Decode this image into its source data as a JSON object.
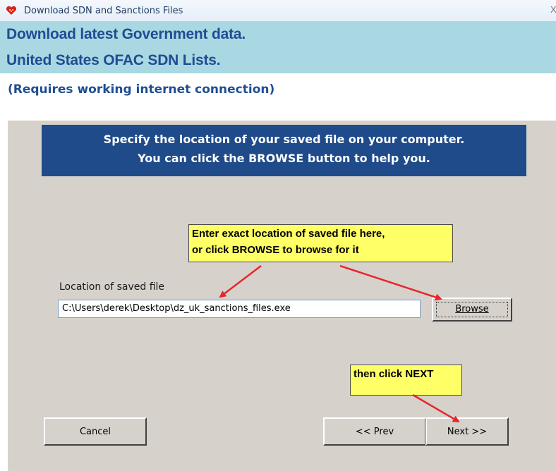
{
  "window": {
    "title": "Download SDN and Sanctions  Files",
    "close_glyph": "X",
    "icon": "heart-app-icon"
  },
  "header": {
    "line1": "Download latest Government data.",
    "line2": "United States OFAC SDN Lists."
  },
  "note": "(Requires working internet connection)",
  "banner": {
    "line1": "Specify the location of your saved file on your computer.",
    "line2": "You can click the BROWSE button to help you."
  },
  "callouts": {
    "location_line1": "Enter exact location of saved file here,",
    "location_line2": "or click BROWSE to browse for it",
    "next": "then click NEXT"
  },
  "location": {
    "label": "Location of saved file",
    "value": "C:\\Users\\derek\\Desktop\\dz_uk_sanctions_files.exe"
  },
  "buttons": {
    "browse": "Browse",
    "cancel": "Cancel",
    "prev": "<< Prev",
    "next": "Next >>"
  },
  "colors": {
    "header_bg": "#a9d7e2",
    "header_text": "#1f4d92",
    "panel_bg": "#d6d2cb",
    "banner_bg": "#1f4b8a",
    "callout_bg": "#ffff66",
    "arrow": "#e8262a"
  }
}
